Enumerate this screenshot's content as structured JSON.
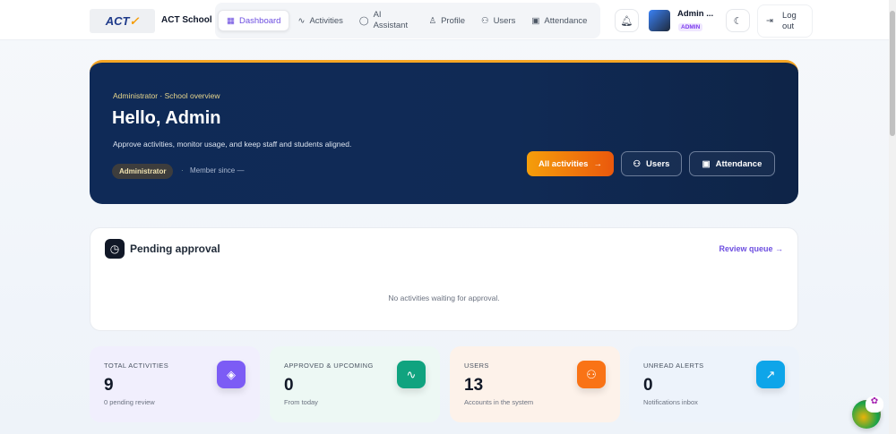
{
  "header": {
    "logo_text": "ACT School",
    "brand": "ACT School",
    "nav": [
      {
        "label": "Dashboard",
        "icon": "grid-icon"
      },
      {
        "label": "Activities",
        "icon": "activity-icon"
      },
      {
        "label": "AI Assistant",
        "icon": "chat-icon"
      },
      {
        "label": "Profile",
        "icon": "user-icon"
      },
      {
        "label": "Users",
        "icon": "users-icon"
      },
      {
        "label": "Attendance",
        "icon": "calendar-icon"
      }
    ],
    "user_name": "Admin ...",
    "user_role": "ADMIN",
    "logout": "Log out"
  },
  "hero": {
    "eyebrow": "Administrator · School overview",
    "title": "Hello, Admin",
    "subtitle": "Approve activities, monitor usage, and keep staff and students aligned.",
    "role_pill": "Administrator",
    "separator": "·",
    "member_since": "Member since —",
    "buttons": {
      "all_activities": "All activities",
      "users": "Users",
      "attendance": "Attendance"
    }
  },
  "pending": {
    "title": "Pending approval",
    "link": "Review queue",
    "empty": "No activities waiting for approval."
  },
  "stats": [
    {
      "label": "TOTAL ACTIVITIES",
      "value": "9",
      "note": "0 pending review",
      "color": "#7c5cf5"
    },
    {
      "label": "APPROVED & UPCOMING",
      "value": "0",
      "note": "From today",
      "color": "#10a37f"
    },
    {
      "label": "USERS",
      "value": "13",
      "note": "Accounts in the system",
      "color": "#f97316"
    },
    {
      "label": "UNREAD ALERTS",
      "value": "0",
      "note": "Notifications inbox",
      "color": "#0ea5e9"
    }
  ]
}
